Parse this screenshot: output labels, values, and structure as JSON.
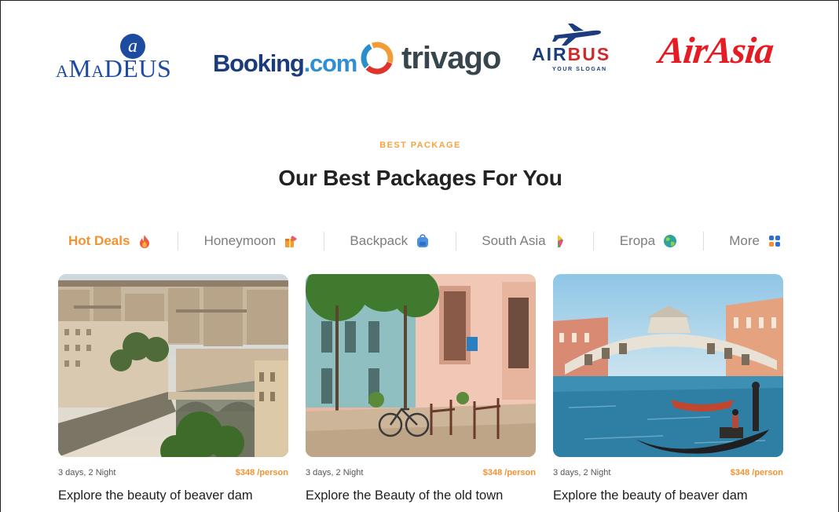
{
  "partners": {
    "amadeus": {
      "badge": "a",
      "word": "aMaDEUS"
    },
    "booking": {
      "part1": "Booking",
      "part2": ".com"
    },
    "trivago": {
      "word": "trivago"
    },
    "airbus": {
      "air": "AIR",
      "bus": "BUS",
      "slogan": "YOUR SLOGAN"
    },
    "airasia": {
      "word": "AirAsia"
    }
  },
  "section": {
    "eyebrow": "BEST PACKAGE",
    "title": "Our Best Packages For You"
  },
  "tabs": [
    {
      "label": "Hot Deals",
      "icon": "fire-icon",
      "active": true
    },
    {
      "label": "Honeymoon",
      "icon": "gift-icon",
      "active": false
    },
    {
      "label": "Backpack",
      "icon": "backpack-icon",
      "active": false
    },
    {
      "label": "South Asia",
      "icon": "flag-icon",
      "active": false
    },
    {
      "label": "Eropa",
      "icon": "globe-icon",
      "active": false
    },
    {
      "label": "More",
      "icon": "grid-icon",
      "active": false
    }
  ],
  "cards": [
    {
      "duration": "3 days, 2 Night",
      "price": "$348 /person",
      "title": "Explore the beauty of beaver dam",
      "image": "paris-cityscape"
    },
    {
      "duration": "3 days, 2 Night",
      "price": "$348 /person",
      "title": "Explore the Beauty of the old town",
      "image": "old-town-street"
    },
    {
      "duration": "3 days, 2 Night",
      "price": "$348 /person",
      "title": "Explore the beauty of beaver dam",
      "image": "venice-rialto"
    }
  ],
  "colors": {
    "accent": "#f39231",
    "eyebrow": "#f9a340",
    "booking_dark": "#1a3b7d",
    "booking_light": "#2f8fd6",
    "airasia": "#e41c23",
    "amadeus": "#1c4ba0"
  }
}
